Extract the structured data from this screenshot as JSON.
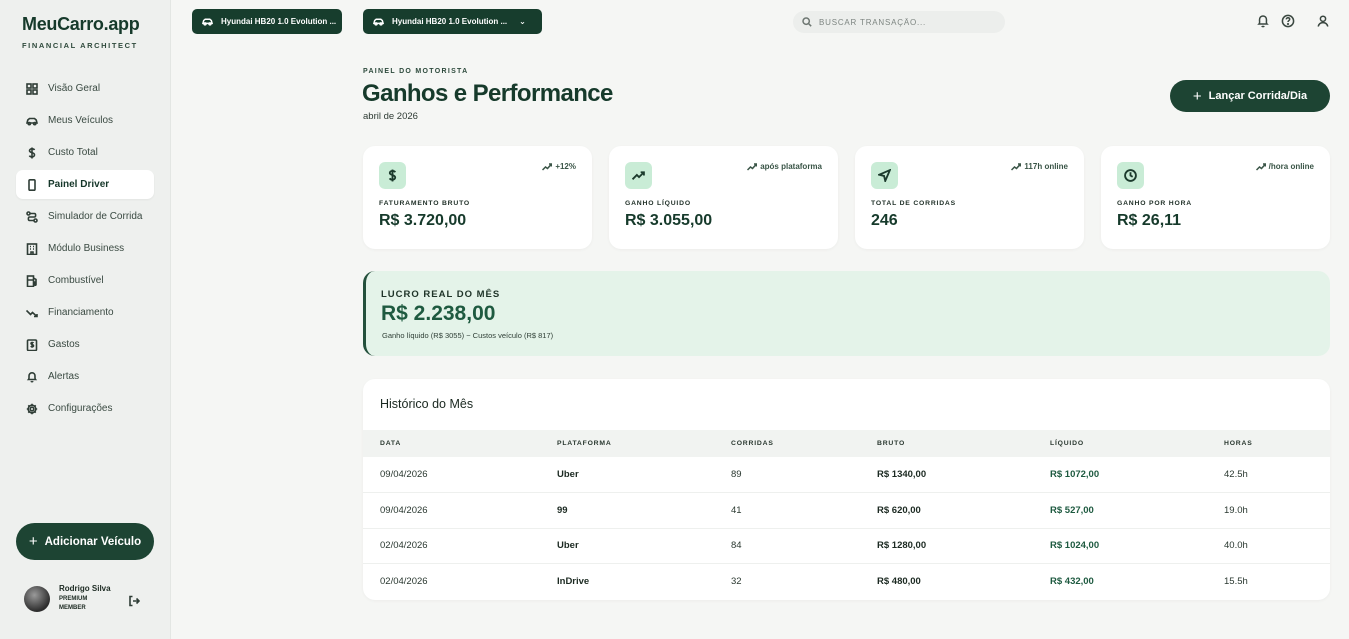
{
  "sidebar": {
    "brand_title": "MeuCarro.app",
    "brand_sub": "FINANCIAL ARCHITECT",
    "items": [
      {
        "label": "Visão Geral",
        "icon": "grid-icon"
      },
      {
        "label": "Meus Veículos",
        "icon": "car-icon"
      },
      {
        "label": "Custo Total",
        "icon": "dollar-icon"
      },
      {
        "label": "Painel Driver",
        "icon": "phone-icon"
      },
      {
        "label": "Simulador de Corrida",
        "icon": "route-icon"
      },
      {
        "label": "Módulo Business",
        "icon": "building-icon"
      },
      {
        "label": "Combustível",
        "icon": "fuel-icon"
      },
      {
        "label": "Financiamento",
        "icon": "trend-down-icon"
      },
      {
        "label": "Gastos",
        "icon": "receipt-icon"
      },
      {
        "label": "Alertas",
        "icon": "bell-icon"
      },
      {
        "label": "Configurações",
        "icon": "gear-icon"
      }
    ],
    "add_vehicle": "Adicionar Veículo",
    "user_name": "Rodrigo Silva",
    "user_role": "PREMIUM MEMBER"
  },
  "topbar": {
    "vehicle_tab_1": "Hyundai HB20 1.0 Evolution ...",
    "vehicle_tab_2": "Hyundai HB20 1.0 Evolution ...",
    "search_placeholder": "BUSCAR TRANSAÇÃO..."
  },
  "header": {
    "eyebrow": "PAINEL DO MOTORISTA",
    "title": "Ganhos e Performance",
    "subtitle": "abril de 2026",
    "launch_button": "Lançar Corrida/Dia"
  },
  "kpis": [
    {
      "label": "FATURAMENTO BRUTO",
      "value": "R$ 3.720,00",
      "trend": "+12%",
      "icon": "dollar-icon"
    },
    {
      "label": "GANHO LÍQUIDO",
      "value": "R$ 3.055,00",
      "trend": "após plataforma",
      "icon": "trend-up-icon"
    },
    {
      "label": "TOTAL DE CORRIDAS",
      "value": "246",
      "trend": "117h online",
      "icon": "navigation-icon"
    },
    {
      "label": "GANHO POR HORA",
      "value": "R$ 26,11",
      "trend": "/hora online",
      "icon": "clock-icon"
    }
  ],
  "profit": {
    "label": "LUCRO REAL DO MÊS",
    "value": "R$ 2.238,00",
    "note": "Ganho líquido (R$ 3055) − Custos veículo (R$ 817)"
  },
  "history": {
    "title": "Histórico do Mês",
    "columns": [
      "DATA",
      "PLATAFORMA",
      "CORRIDAS",
      "BRUTO",
      "LÍQUIDO",
      "HORAS"
    ],
    "rows": [
      [
        "09/04/2026",
        "Uber",
        "89",
        "R$ 1340,00",
        "R$ 1072,00",
        "42.5h"
      ],
      [
        "09/04/2026",
        "99",
        "41",
        "R$ 620,00",
        "R$ 527,00",
        "19.0h"
      ],
      [
        "02/04/2026",
        "Uber",
        "84",
        "R$ 1280,00",
        "R$ 1024,00",
        "40.0h"
      ],
      [
        "02/04/2026",
        "InDrive",
        "32",
        "R$ 480,00",
        "R$ 432,00",
        "15.5h"
      ]
    ]
  },
  "colors": {
    "brand_dark": "#1d4433",
    "accent_green": "#1e5a40",
    "icon_bg": "#c9ecd6",
    "profit_bg": "#e4f3e9"
  }
}
